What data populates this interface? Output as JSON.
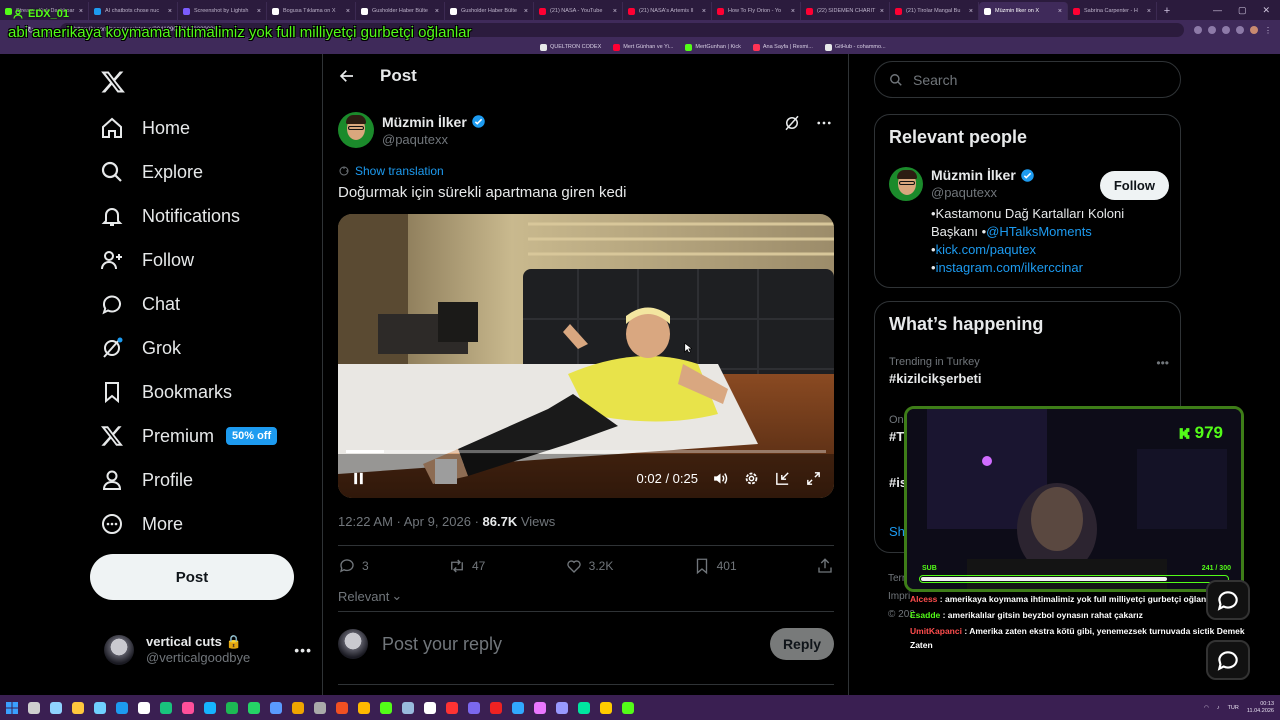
{
  "browser": {
    "tabs": [
      {
        "label": "Stream - Kick Dashboar",
        "color": "#53fc18",
        "active": false
      },
      {
        "label": "AI chatbots chose nuc",
        "color": "#1d9bf0",
        "active": false
      },
      {
        "label": "Screenshot by Lightsh",
        "color": "#7b5cff",
        "active": false
      },
      {
        "label": "Bogusa Tıklama on X",
        "color": "#ffffff",
        "active": false
      },
      {
        "label": "Gusholder Haber Bülte",
        "color": "#ffffff",
        "active": false
      },
      {
        "label": "Gusholder Haber Bülte",
        "color": "#ffffff",
        "active": false
      },
      {
        "label": "(21) NASA - YouTube",
        "color": "#ff0033",
        "active": false
      },
      {
        "label": "(21) NASA's Artemis II",
        "color": "#ff0033",
        "active": false
      },
      {
        "label": "How To Fly Orion - Yo",
        "color": "#ff0033",
        "active": false
      },
      {
        "label": "(22) SIDEMEN CHARIT",
        "color": "#ff0033",
        "active": false
      },
      {
        "label": "(21) Tirolar Mangal Bu",
        "color": "#ff0033",
        "active": false
      },
      {
        "label": "Müzmin İlker on X",
        "color": "#ffffff",
        "active": true
      },
      {
        "label": "Sabrina Carpenter - H",
        "color": "#ff0033",
        "active": false
      }
    ],
    "new_tab": "+",
    "url": "https://x.com/paqutexx/status/2041990201040339038",
    "bookmarks": [
      {
        "label": "QUELTRON CODEX",
        "color": "#e7e9ea"
      },
      {
        "label": "Mert Günhan ve Yi...",
        "color": "#ff0033"
      },
      {
        "label": "MertGunhan | Kick",
        "color": "#53fc18"
      },
      {
        "label": "Ana Sayfa | Resmi...",
        "color": "#ff3355"
      },
      {
        "label": "GitHub - cohammo...",
        "color": "#e7e9ea"
      }
    ]
  },
  "overlay": {
    "username": "EDX_01",
    "marquee": "abi amerikaya koymama ihtimalimiz yok full milliyetçi gurbetçi oğlanlar"
  },
  "nav": {
    "items": [
      {
        "label": "Home",
        "icon": "home-icon"
      },
      {
        "label": "Explore",
        "icon": "search-icon"
      },
      {
        "label": "Notifications",
        "icon": "bell-icon"
      },
      {
        "label": "Follow",
        "icon": "follow-icon"
      },
      {
        "label": "Chat",
        "icon": "chat-icon"
      },
      {
        "label": "Grok",
        "icon": "grok-icon"
      },
      {
        "label": "Bookmarks",
        "icon": "bookmark-icon"
      },
      {
        "label": "Premium",
        "icon": "x-icon"
      },
      {
        "label": "Profile",
        "icon": "person-icon"
      },
      {
        "label": "More",
        "icon": "more-icon"
      }
    ],
    "premium_badge": "50% off",
    "post_button": "Post",
    "account": {
      "name": "vertical cuts",
      "handle": "@verticalgoodbye"
    }
  },
  "post": {
    "header_title": "Post",
    "author_name": "Müzmin İlker",
    "author_handle": "@paqutexx",
    "show_translation": "Show translation",
    "text": "Doğurmak için sürekli apartmana giren kedi",
    "video": {
      "time": "0:02 / 0:25",
      "progress": 0.08
    },
    "meta_time": "12:22 AM · Apr 9, 2026 · ",
    "views_count": "86.7K",
    "views_label": " Views",
    "stats": {
      "replies": "3",
      "reposts": "47",
      "likes": "3.2K",
      "bookmarks": "401"
    },
    "relevant_label": "Relevant",
    "reply_placeholder": "Post your reply",
    "reply_button": "Reply"
  },
  "sidebar": {
    "search_placeholder": "Search",
    "relevant_title": "Relevant people",
    "person": {
      "name": "Müzmin İlker",
      "handle": "@paqutexx",
      "follow": "Follow",
      "bio_1": "•Kastamonu Dağ Kartalları Koloni Başkanı •",
      "bio_link_1": "@HTalksMoments",
      "bio_2": "•",
      "bio_link_2": "kick.com/paqutex",
      "bio_3": "•",
      "bio_link_3": "instagram.com/ilkerccinar"
    },
    "happening_title": "What’s happening",
    "trends": [
      {
        "context": "Trending in Turkey",
        "name": "#kizilcikşerbeti"
      },
      {
        "context": "On",
        "name": "#T"
      },
      {
        "context": "",
        "name": "#is"
      }
    ],
    "show_more": "Sh",
    "footer_1": "Terr",
    "footer_2": "Impri",
    "footer_3": "© 202"
  },
  "stream": {
    "kick_viewers": "979",
    "sub_label": "SUB",
    "sub_progress": "241 / 300",
    "chat": [
      {
        "user": "Alcess",
        "text": " : amerikaya koymama ihtimalimiz yok full milliyetçi gurbetçi oğlanlar",
        "color": "red"
      },
      {
        "user": "Esadde",
        "text": " : amerikalılar gitsin beyzbol oynasın rahat çakarız",
        "color": "green"
      },
      {
        "user": "UmitKapanci",
        "text": " : Amerika zaten ekstra kötü gibi, yenemezsek turnuvada sictik Demek Zaten",
        "color": "red"
      }
    ]
  },
  "taskbar": {
    "lang": "TUR",
    "time": "00:13",
    "date": "11.04.2026"
  },
  "colors": {
    "accent": "#1d9bf0",
    "kick_green": "#53fc18",
    "browser_purple": "#3f2a5a"
  }
}
